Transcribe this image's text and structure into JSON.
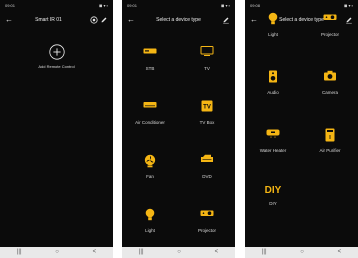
{
  "screen1": {
    "status_time": "09:01",
    "status_icons": "◼ ▾ ▪",
    "back_icon": "arrow-left",
    "title": "Smart IR 01",
    "add_label": "Add Remote Control"
  },
  "screen2": {
    "status_time": "09:01",
    "status_icons": "◼ ▾ ▪",
    "title": "Select a device type",
    "devices": [
      {
        "label": "STB",
        "icon": "stb-icon"
      },
      {
        "label": "TV",
        "icon": "tv-icon"
      },
      {
        "label": "Air Conditioner",
        "icon": "air-conditioner-icon"
      },
      {
        "label": "TV Box",
        "icon": "tv-box-icon"
      },
      {
        "label": "Fan",
        "icon": "fan-icon"
      },
      {
        "label": "DVD",
        "icon": "dvd-icon"
      },
      {
        "label": "Light",
        "icon": "light-icon"
      },
      {
        "label": "Projector",
        "icon": "projector-icon"
      }
    ]
  },
  "screen3": {
    "status_time": "09:08",
    "status_icons": "◼ ▾ ▪",
    "title": "Select a device type",
    "devices": [
      {
        "label": "Light",
        "icon": "light-icon"
      },
      {
        "label": "Projector",
        "icon": "projector-icon"
      },
      {
        "label": "Audio",
        "icon": "audio-icon"
      },
      {
        "label": "Camera",
        "icon": "camera-icon"
      },
      {
        "label": "Water Heater",
        "icon": "water-heater-icon"
      },
      {
        "label": "Air Purifier",
        "icon": "air-purifier-icon"
      },
      {
        "label": "DIY",
        "icon": "diy-icon"
      }
    ],
    "diy_text": "DIY"
  },
  "navbar": {
    "recent": "|||",
    "home": "○",
    "back": "<"
  },
  "colors": {
    "background": "#0b0b0b",
    "accent": "#f5b614",
    "navbar": "#e9e9e9"
  }
}
